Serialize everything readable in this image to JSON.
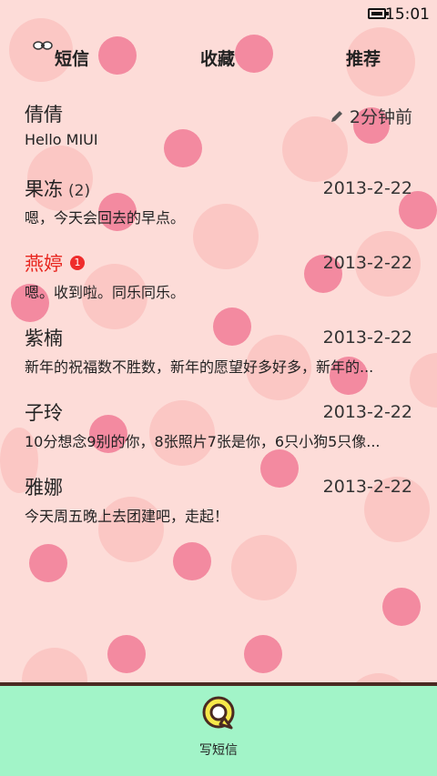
{
  "status_bar": {
    "time": "15:01"
  },
  "tabs": [
    {
      "label": "短信"
    },
    {
      "label": "收藏"
    },
    {
      "label": "推荐"
    }
  ],
  "conversations": [
    {
      "name": "倩倩",
      "count": "",
      "unread": false,
      "time": "2分钟前",
      "draft": true,
      "preview": "Hello MIUI"
    },
    {
      "name": "果冻",
      "count": "(2)",
      "unread": false,
      "time": "2013-2-22",
      "draft": false,
      "preview": "嗯，今天会回去的早点。"
    },
    {
      "name": "燕婷",
      "count": "",
      "unread": true,
      "unread_badge": "1",
      "time": "2013-2-22",
      "draft": false,
      "preview": "嗯。收到啦。同乐同乐。"
    },
    {
      "name": "紫楠",
      "count": "",
      "unread": false,
      "time": "2013-2-22",
      "draft": false,
      "preview": "新年的祝福数不胜数，新年的愿望好多好多，新年的..."
    },
    {
      "name": "子玲",
      "count": "",
      "unread": false,
      "time": "2013-2-22",
      "draft": false,
      "preview": "10分想念9别的你，8张照片7张是你，6只小狗5只像..."
    },
    {
      "name": "雅娜",
      "count": "",
      "unread": false,
      "time": "2013-2-22",
      "draft": false,
      "preview": "今天周五晚上去团建吧，走起！"
    }
  ],
  "bottom_bar": {
    "compose_label": "写短信"
  },
  "colors": {
    "background": "#fddcd8",
    "dot_dark": "#f38aa0",
    "dot_light": "#fbc7c4",
    "bottom_bar": "#a2f4c8",
    "unread_name": "#e8261f",
    "badge": "#ef2c2c"
  },
  "icons": [
    "battery-icon",
    "bow-icon",
    "pencil-icon",
    "compose-message-icon"
  ]
}
